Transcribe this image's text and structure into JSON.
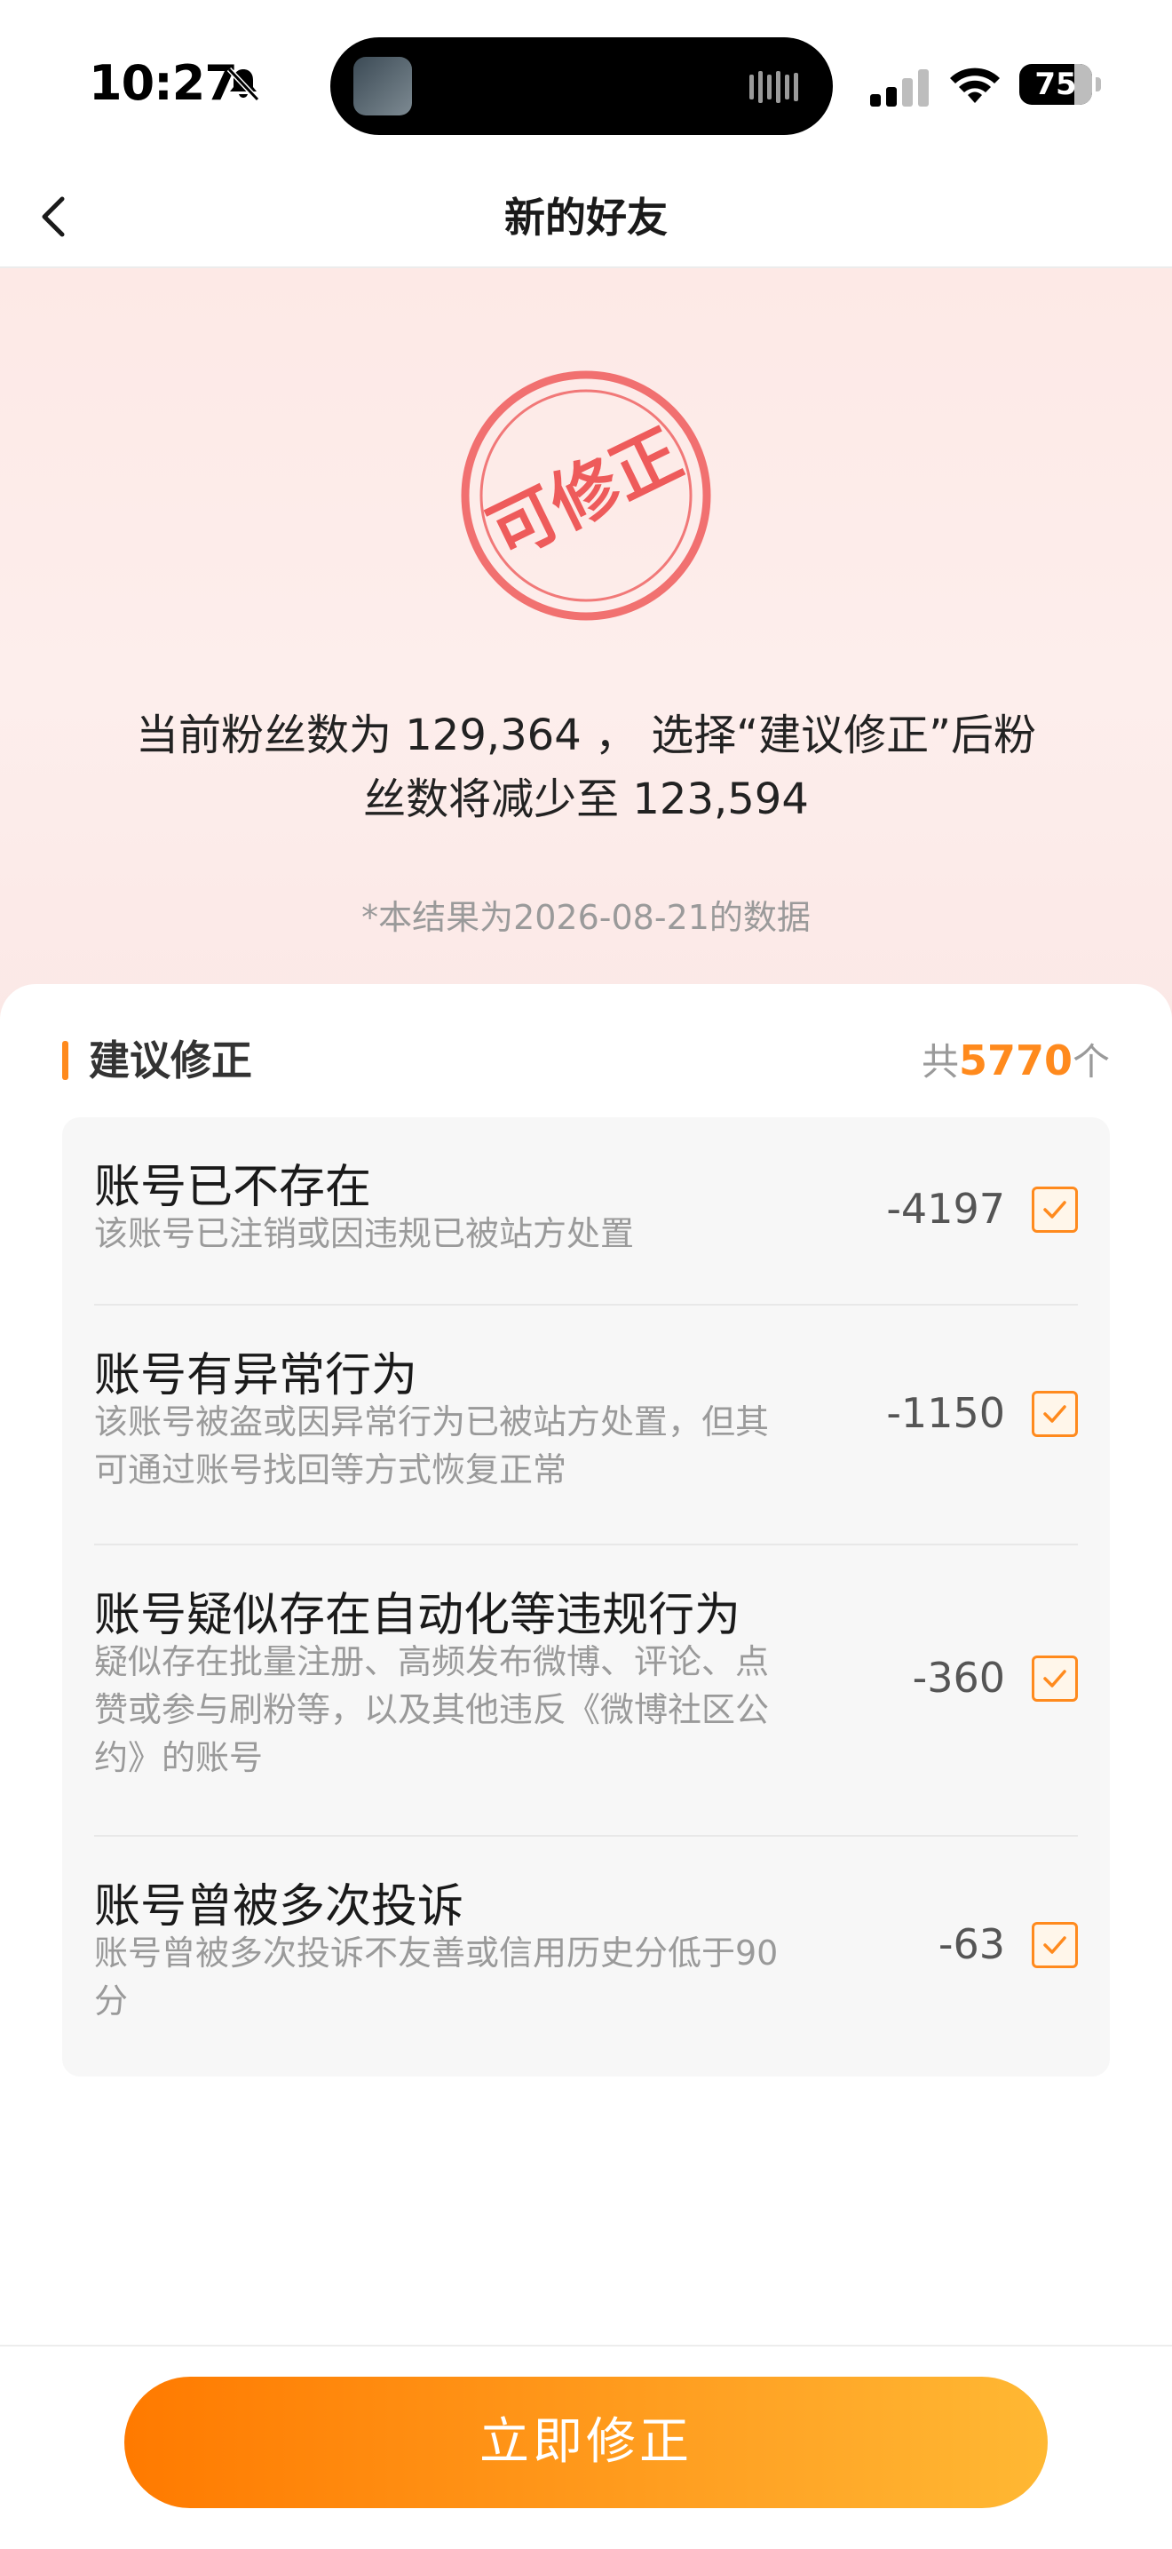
{
  "status_bar": {
    "time": "10:27",
    "battery": "75",
    "icons": [
      "bell-slash-icon",
      "audio-waveform-icon",
      "cellular-signal-icon",
      "wifi-icon",
      "battery-icon"
    ]
  },
  "nav": {
    "title": "新的好友",
    "back_icon": "chevron-left-icon"
  },
  "hero": {
    "stamp_text": "可修正",
    "summary_line1": "当前粉丝数为 129,364 ， 选择“建议修正”后粉",
    "summary_line2": "丝数将减少至 123,594",
    "data_note": "*本结果为2026-08-21的数据"
  },
  "section": {
    "title": "建议修正",
    "total_prefix": "共",
    "total_count": "5770",
    "total_suffix": "个"
  },
  "items": [
    {
      "title": "账号已不存在",
      "desc_lines": [
        "该账号已注销或因违规已被站方处置"
      ],
      "count": "-4197",
      "checked": true
    },
    {
      "title": "账号有异常行为",
      "desc_lines": [
        "该账号被盗或因异常行为已被站方处置，但其",
        "可通过账号找回等方式恢复正常"
      ],
      "count": "-1150",
      "checked": true
    },
    {
      "title": "账号疑似存在自动化等违规行为",
      "desc_lines": [
        "疑似存在批量注册、高频发布微博、评论、点",
        "赞或参与刷粉等，以及其他违反《微博社区公",
        "约》的账号"
      ],
      "count": "-360",
      "checked": true
    },
    {
      "title": "账号曾被多次投诉",
      "desc_lines": [
        "账号曾被多次投诉不友善或信用历史分低于90",
        "分"
      ],
      "count": "-63",
      "checked": true
    }
  ],
  "action": {
    "fix_label": "立即修正"
  },
  "colors": {
    "accent": "#ff8a1d",
    "stamp": "#ee5b5b",
    "hero_bg": "#fdeae7"
  }
}
